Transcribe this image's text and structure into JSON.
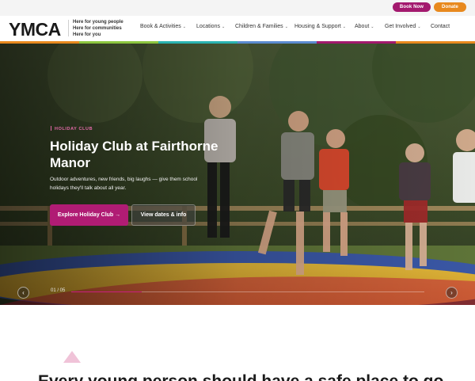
{
  "utility": {
    "book_now": "Book Now",
    "donate": "Donate",
    "book_color": "#a3196e",
    "donate_color": "#e8891e"
  },
  "brand": {
    "logo_text": "YMCA",
    "tagline": [
      "Here for young people",
      "Here for communities",
      "Here for you"
    ]
  },
  "nav": {
    "items": [
      {
        "label": "Book & Activities",
        "dropdown": true
      },
      {
        "label": "Locations",
        "dropdown": true
      },
      {
        "label": "Children & Families",
        "dropdown": true
      },
      {
        "label": "Housing & Support",
        "dropdown": true
      },
      {
        "label": "About",
        "dropdown": true
      },
      {
        "label": "Get Involved",
        "dropdown": true
      },
      {
        "label": "Contact",
        "dropdown": false
      }
    ],
    "chevron_icon": "chevron-down-icon"
  },
  "stripe_colors": [
    "#e8891e",
    "#8cc63f",
    "#2ab3b1",
    "#5b8bd0",
    "#a3196e",
    "#e8891e"
  ],
  "hero": {
    "eyebrow": "HOLIDAY CLUB",
    "title": "Holiday Club at Fairthorne Manor",
    "description": "Outdoor adventures, new friends, big laughs — give them school holidays they'll talk about all year.",
    "primary_cta": "Explore Holiday Club →",
    "secondary_cta": "View dates & info",
    "slide_counter": "01 / 05",
    "slide_progress": 0.2,
    "prev_icon": "chevron-left-icon",
    "next_icon": "chevron-right-icon",
    "accent": "#b01c74"
  },
  "section": {
    "heading": "Every young person should have a safe place to go, to belong and to thrive"
  }
}
